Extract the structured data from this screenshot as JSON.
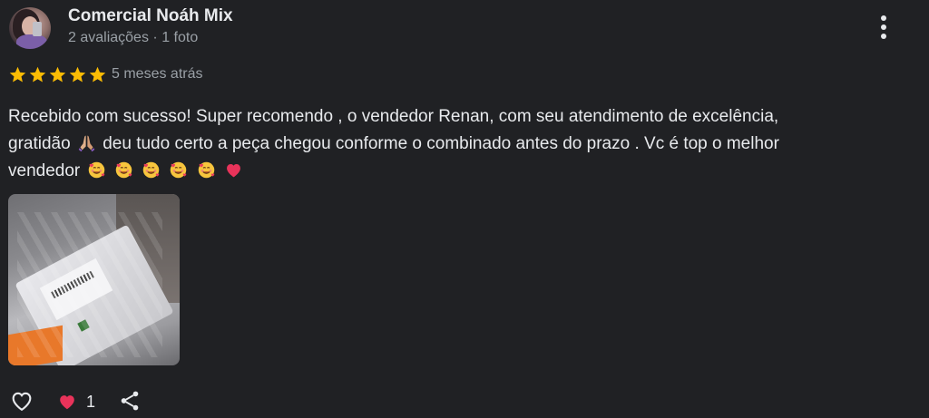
{
  "reviewer": {
    "name": "Comercial Noáh Mix",
    "reviews_count": "2 avaliações",
    "separator": "·",
    "photos_count": "1 foto"
  },
  "rating": {
    "stars": 5,
    "max_stars": 5,
    "star_color": "#fbbc04",
    "time_ago": "5 meses atrás"
  },
  "review": {
    "line1": "Recebido com sucesso! Super recomendo , o vendedor Renan, com seu atendimento de excelência,",
    "line2_a": "gratidão",
    "line2_b": "deu tudo certo a peça chegou conforme o combinado antes do prazo . Vc é top o melhor",
    "line3": "vendedor",
    "emojis": [
      "folded-hands",
      "smiling-face-with-hearts",
      "smiling-face-with-hearts",
      "smiling-face-with-hearts",
      "smiling-face-with-hearts",
      "smiling-face-with-hearts",
      "heart"
    ]
  },
  "photo": {
    "icon": "review-photo-package"
  },
  "actions": {
    "like_icon": "heart-outline-icon",
    "reaction_icon": "heart-icon",
    "reaction_count": "1",
    "share_icon": "share-icon",
    "reaction_color": "#e8335a"
  },
  "menu": {
    "icon": "more-vert-icon"
  }
}
